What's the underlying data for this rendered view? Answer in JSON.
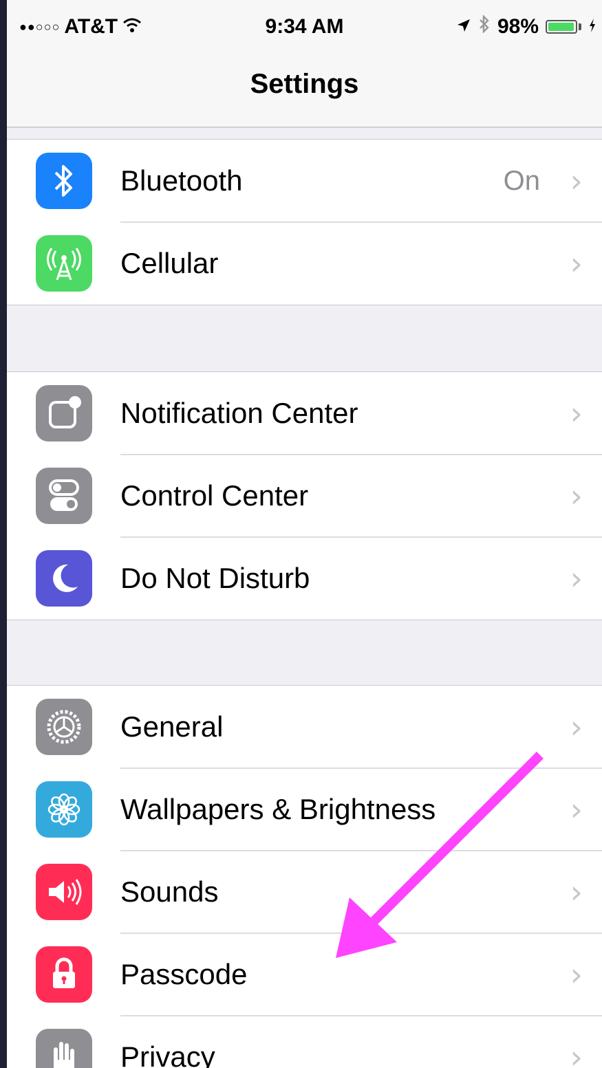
{
  "status_bar": {
    "signal": "●●○○○",
    "carrier": "AT&T",
    "time": "9:34 AM",
    "battery_percent": "98%",
    "battery_level": 0.98
  },
  "nav": {
    "title": "Settings"
  },
  "groups": [
    {
      "items": [
        {
          "label": "Bluetooth",
          "detail": "On",
          "icon": "bluetooth-icon",
          "icon_color": "#1a82fb"
        },
        {
          "label": "Cellular",
          "detail": "",
          "icon": "cellular-antenna-icon",
          "icon_color": "#4cd964"
        }
      ]
    },
    {
      "items": [
        {
          "label": "Notification Center",
          "icon": "notification-center-icon",
          "icon_color": "#8e8e93"
        },
        {
          "label": "Control Center",
          "icon": "control-center-toggles-icon",
          "icon_color": "#8e8e93"
        },
        {
          "label": "Do Not Disturb",
          "icon": "moon-icon",
          "icon_color": "#5856d6"
        }
      ]
    },
    {
      "items": [
        {
          "label": "General",
          "icon": "gear-icon",
          "icon_color": "#8e8e93"
        },
        {
          "label": "Wallpapers & Brightness",
          "icon": "flower-icon",
          "icon_color": "#34aadc"
        },
        {
          "label": "Sounds",
          "icon": "speaker-icon",
          "icon_color": "#ff2d55"
        },
        {
          "label": "Passcode",
          "icon": "lock-icon",
          "icon_color": "#ff2d55"
        },
        {
          "label": "Privacy",
          "icon": "hand-icon",
          "icon_color": "#8e8e93"
        }
      ]
    }
  ],
  "annotation": {
    "arrow_color": "#ff44ff"
  }
}
